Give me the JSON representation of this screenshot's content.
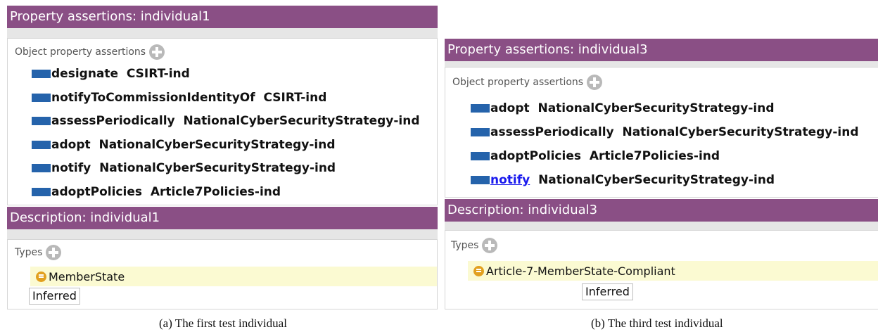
{
  "panel_a": {
    "property_title": "Property assertions: individual1",
    "object_property_header": "Object property assertions",
    "object_properties": [
      {
        "property": "designate",
        "value": "CSIRT-ind"
      },
      {
        "property": "notifyToCommissionIdentityOf",
        "value": "CSIRT-ind"
      },
      {
        "property": "assessPeriodically",
        "value": "NationalCyberSecurityStrategy-ind"
      },
      {
        "property": "adopt",
        "value": "NationalCyberSecurityStrategy-ind"
      },
      {
        "property": "notify",
        "value": "NationalCyberSecurityStrategy-ind"
      },
      {
        "property": "adoptPolicies",
        "value": "Article7Policies-ind"
      }
    ],
    "description_title": "Description: individual1",
    "types_header": "Types",
    "type_value": "MemberState",
    "inferred_label": "Inferred",
    "caption": "(a) The first test individual"
  },
  "panel_b": {
    "property_title": "Property assertions: individual3",
    "object_property_header": "Object property assertions",
    "object_properties": [
      {
        "property": "adopt",
        "value": "NationalCyberSecurityStrategy-ind"
      },
      {
        "property": "assessPeriodically",
        "value": "NationalCyberSecurityStrategy-ind"
      },
      {
        "property": "adoptPolicies",
        "value": "Article7Policies-ind"
      },
      {
        "property": "notify",
        "value": "NationalCyberSecurityStrategy-ind",
        "link": true
      }
    ],
    "description_title": "Description: individual3",
    "types_header": "Types",
    "type_value": "Article-7-MemberState-Compliant",
    "inferred_label": "Inferred",
    "caption": "(b) The third test individual"
  },
  "colors": {
    "title_bar": "#8a4f85",
    "property_icon": "#2563ab",
    "class_icon": "#e2a01f",
    "type_highlight": "#fbfad2",
    "link": "#1a1aee"
  },
  "icons": {
    "add": "plus-circle-icon",
    "object_property": "object-property-icon",
    "class": "class-icon"
  }
}
